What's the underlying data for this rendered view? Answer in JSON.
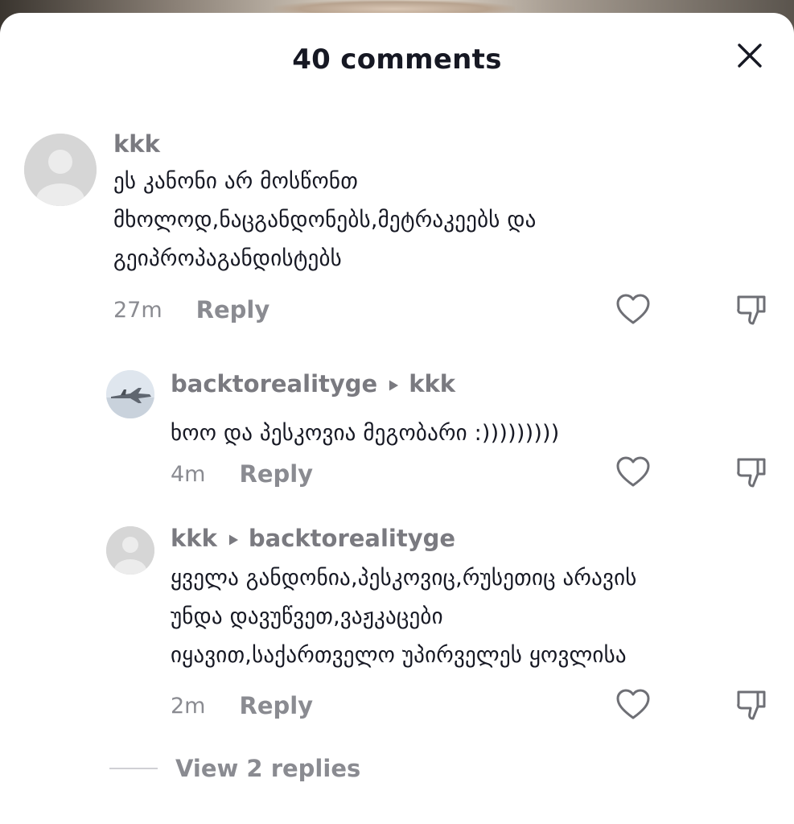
{
  "header": {
    "title": "40 comments"
  },
  "comments": [
    {
      "username": "kkk",
      "reply_to": "",
      "text": "ეს კანონი არ მოსწონთ\nმხოლოდ,ნაცგანდონებს,მეტრაკეებს და\nგეიპროპაგანდისტებს",
      "time": "27m",
      "reply_label": "Reply",
      "avatar": "default-avatar"
    },
    {
      "username": "backtorealityge",
      "reply_to": "kkk",
      "text": "ხოო და პესკოვია მეგობარი :)))))))))",
      "time": "4m",
      "reply_label": "Reply",
      "avatar": "jet-avatar"
    },
    {
      "username": "kkk",
      "reply_to": "backtorealityge",
      "text": "ყველა განდონია,პესკოვიც,რუსეთიც არავის\nუნდა დავუწვეთ,ვაჟკაცები\nიყავით,საქართველო უპირველეს ყოვლისა",
      "time": "2m",
      "reply_label": "Reply",
      "avatar": "default-avatar"
    }
  ],
  "view_replies": {
    "label": "View 2 replies"
  },
  "icons": {
    "close": "close-icon",
    "like": "heart-icon",
    "dislike": "thumbs-down-icon",
    "reply_to": "triangle-right-icon"
  },
  "colors": {
    "text_primary": "#161823",
    "text_secondary": "#8a8b91",
    "avatar_bg": "#d6d6d6"
  }
}
